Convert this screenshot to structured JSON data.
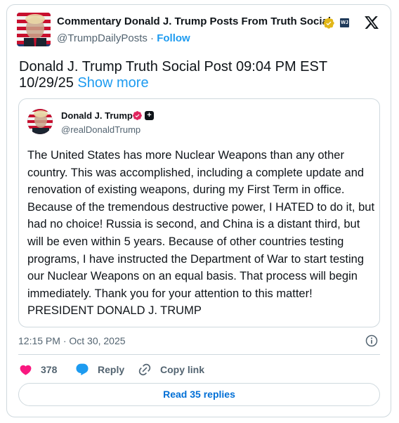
{
  "header": {
    "account_name": "Commentary Donald J. Trump Posts From Truth Social",
    "handle": "@TrumpDailyPosts",
    "separator": " · ",
    "follow_label": "Follow",
    "wj_badge_text": "WJ"
  },
  "post": {
    "text": "Donald J. Trump Truth Social Post 09:04 PM EST 10/29/25",
    "show_more_label": "Show more"
  },
  "quoted": {
    "name": "Donald J. Trump",
    "handle": "@realDonaldTrump",
    "body": "The United States has more Nuclear Weapons than any other country. This was accomplished, including a complete update and renovation of existing weapons, during my First Term in office. Because of the tremendous destructive power, I HATED to do it, but had no choice! Russia is second, and China is a distant third, but will be even within 5 years. Because of other countries testing programs, I have instructed the Department of War to start testing our Nuclear Weapons on an equal basis. That process will begin immediately. Thank you for your attention to this matter! PRESIDENT DONALD J. TRUMP"
  },
  "meta": {
    "timestamp": "12:15 PM · Oct 30, 2025"
  },
  "actions": {
    "like_count": "378",
    "reply_label": "Reply",
    "copy_link_label": "Copy link",
    "read_replies_label": "Read 35 replies"
  },
  "icons": {
    "verified_gold": "verified-gold-icon",
    "verified_pink": "verified-pink-icon",
    "x_logo": "x-logo-icon",
    "info": "info-icon",
    "heart": "heart-icon",
    "reply": "reply-bubble-icon",
    "link": "link-icon"
  },
  "colors": {
    "link_blue": "#1d9bf0",
    "heart_red": "#f91880",
    "verified_gold": "#e2b719",
    "verified_pink": "#e0245e",
    "muted": "#536471",
    "border": "#cfd9de"
  }
}
